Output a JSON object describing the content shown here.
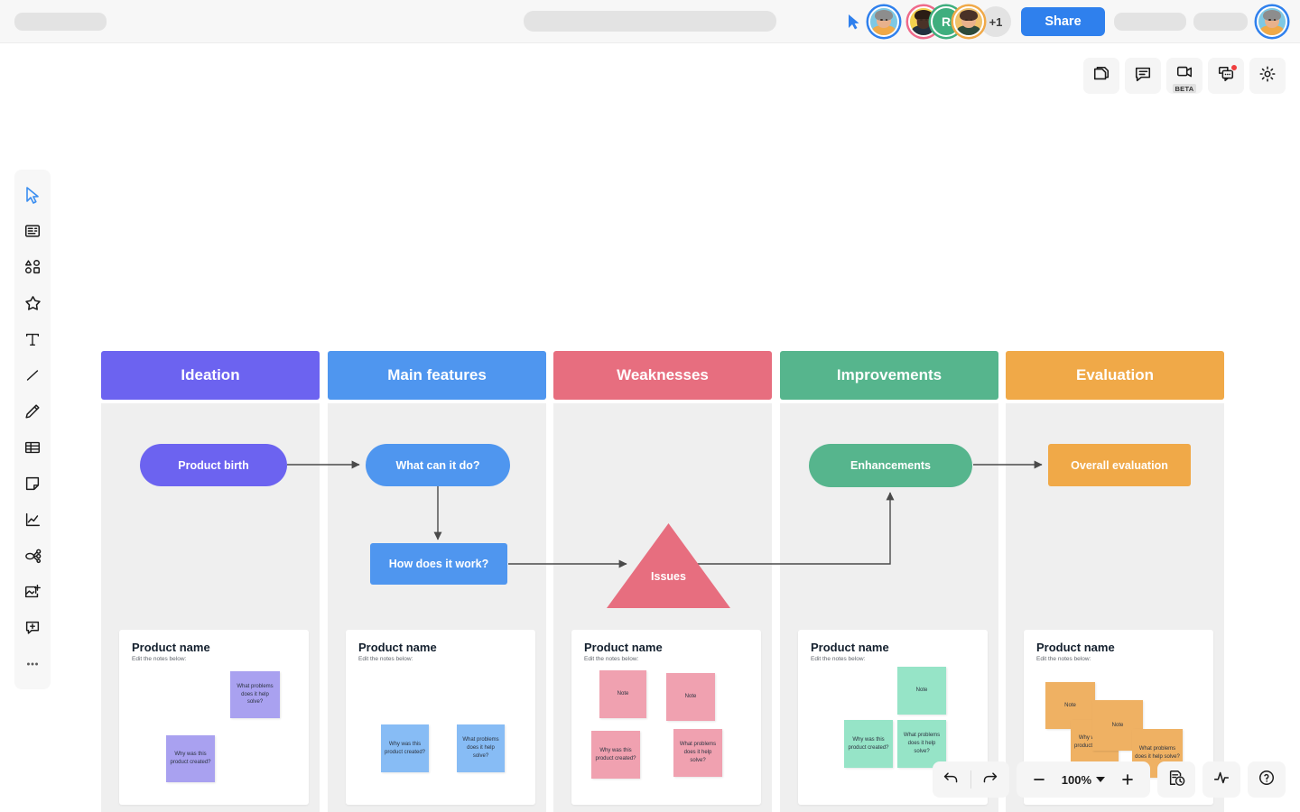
{
  "topbar": {
    "cursor_icon": "cursor-pointer-icon",
    "share_label": "Share",
    "overflow_count": "+1",
    "collaborator_initial": "R"
  },
  "top_tools": [
    {
      "name": "pages-icon",
      "label": "Pages",
      "badge": ""
    },
    {
      "name": "comment-icon",
      "label": "Comments",
      "badge": ""
    },
    {
      "name": "video-call-icon",
      "label": "Video call",
      "badge": "BETA"
    },
    {
      "name": "chat-icon",
      "label": "Chat",
      "badge": ""
    },
    {
      "name": "gear-icon",
      "label": "Settings",
      "badge": ""
    }
  ],
  "left_tools": [
    {
      "name": "select-icon",
      "label": "Select"
    },
    {
      "name": "template-icon",
      "label": "Templates"
    },
    {
      "name": "shapes-icon",
      "label": "Shapes"
    },
    {
      "name": "star-icon",
      "label": "Icons"
    },
    {
      "name": "text-icon",
      "label": "Text"
    },
    {
      "name": "line-icon",
      "label": "Line"
    },
    {
      "name": "pen-icon",
      "label": "Pen"
    },
    {
      "name": "table-icon",
      "label": "Table"
    },
    {
      "name": "sticky-note-icon",
      "label": "Sticky note"
    },
    {
      "name": "chart-icon",
      "label": "Chart"
    },
    {
      "name": "mindmap-icon",
      "label": "Mind map"
    },
    {
      "name": "image-add-icon",
      "label": "Add image"
    },
    {
      "name": "comment-add-icon",
      "label": "Add comment"
    },
    {
      "name": "more-icon",
      "label": "More"
    }
  ],
  "board": {
    "columns": [
      {
        "title": "Ideation",
        "color": "#6C63F0",
        "card": {
          "title": "Product name",
          "subtitle": "Edit the notes below:"
        },
        "notes": [
          {
            "text": "What problems does it help solve?",
            "color": "#A9A1F0"
          },
          {
            "text": "Why was this product created?",
            "color": "#A9A1F0"
          }
        ]
      },
      {
        "title": "Main features",
        "color": "#4F96EF",
        "card": {
          "title": "Product name",
          "subtitle": "Edit the notes below:"
        },
        "notes": [
          {
            "text": "Why was this product created?",
            "color": "#87BCF5"
          },
          {
            "text": "What problems does it help solve?",
            "color": "#87BCF5"
          }
        ]
      },
      {
        "title": "Weaknesses",
        "color": "#E76E7F",
        "card": {
          "title": "Product name",
          "subtitle": "Edit the notes below:"
        },
        "notes": [
          {
            "text": "Note",
            "color": "#F0A1B0"
          },
          {
            "text": "Note",
            "color": "#F0A1B0"
          },
          {
            "text": "Why was this product created?",
            "color": "#F0A1B0"
          },
          {
            "text": "What problems does it help solve?",
            "color": "#F0A1B0"
          }
        ]
      },
      {
        "title": "Improvements",
        "color": "#56B58D",
        "card": {
          "title": "Product name",
          "subtitle": "Edit the notes below:"
        },
        "notes": [
          {
            "text": "Note",
            "color": "#96E4C7"
          },
          {
            "text": "Why was this product created?",
            "color": "#96E4C7"
          },
          {
            "text": "What problems does it help solve?",
            "color": "#96E4C7"
          }
        ]
      },
      {
        "title": "Evaluation",
        "color": "#F0A948",
        "card": {
          "title": "Product name",
          "subtitle": "Edit the notes below:"
        },
        "notes": [
          {
            "text": "Note",
            "color": "#EFB163"
          },
          {
            "text": "Note",
            "color": "#EFB163"
          },
          {
            "text": "Why was this product created?",
            "color": "#EFB163"
          },
          {
            "text": "What problems does it help solve?",
            "color": "#EFB163"
          }
        ]
      }
    ],
    "shapes": [
      {
        "id": "product-birth",
        "label": "Product birth",
        "color": "#6C63F0",
        "type": "pill"
      },
      {
        "id": "what-can-it-do",
        "label": "What can it do?",
        "color": "#4F96EF",
        "type": "pill"
      },
      {
        "id": "how-does-it-work",
        "label": "How does it work?",
        "color": "#4F96EF",
        "type": "rect"
      },
      {
        "id": "issues",
        "label": "Issues",
        "color": "#E76E7F",
        "type": "triangle"
      },
      {
        "id": "enhancements",
        "label": "Enhancements",
        "color": "#56B58D",
        "type": "pill"
      },
      {
        "id": "overall-evaluation",
        "label": "Overall evaluation",
        "color": "#F0A948",
        "type": "rect"
      }
    ]
  },
  "bottombar": {
    "undo_icon": "undo-icon",
    "redo_icon": "redo-icon",
    "zoom_out_label": "−",
    "zoom_level": "100%",
    "zoom_in_label": "+",
    "history_icon": "version-history-icon",
    "activity_icon": "activity-icon",
    "help_icon": "help-icon"
  }
}
